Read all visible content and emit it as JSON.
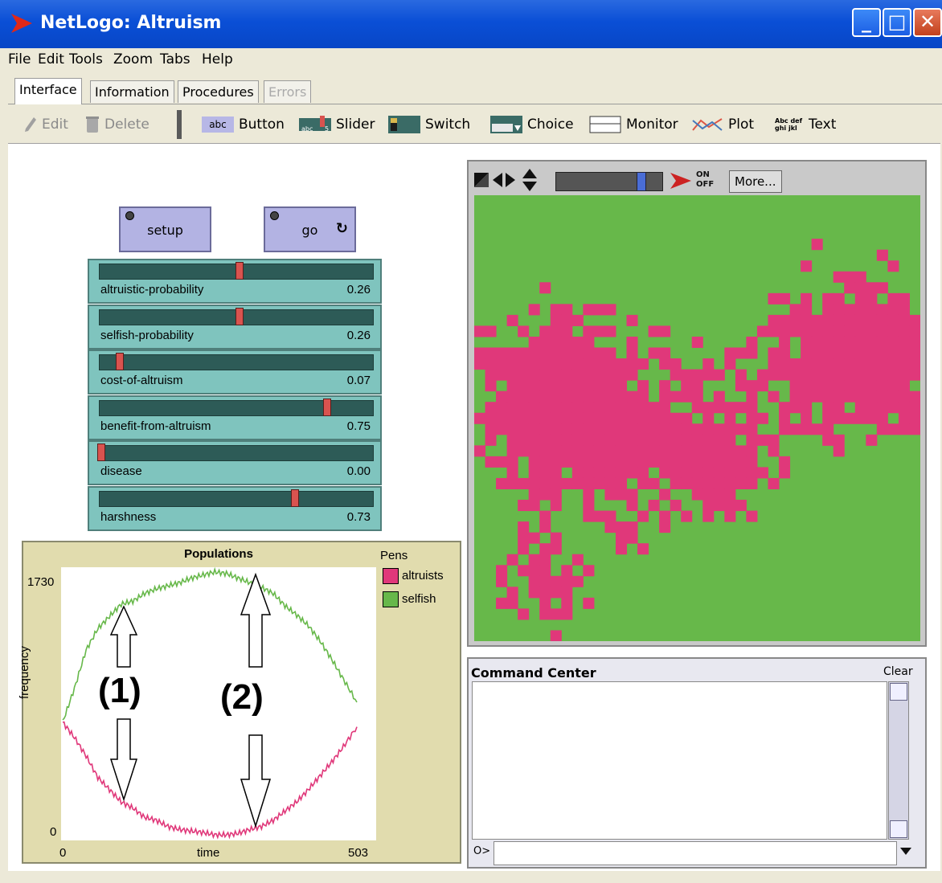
{
  "window": {
    "title": "NetLogo: Altruism"
  },
  "menu": [
    "File",
    "Edit",
    "Tools",
    "Zoom",
    "Tabs",
    "Help"
  ],
  "tabs": [
    "Interface",
    "Information",
    "Procedures",
    "Errors"
  ],
  "toolbar": {
    "edit": "Edit",
    "delete": "Delete",
    "button": "Button",
    "slider": "Slider",
    "switch": "Switch",
    "choice": "Choice",
    "monitor": "Monitor",
    "plot": "Plot",
    "text": "Text",
    "button_icon_text": "abc",
    "text_icon_text": "Abc def ghi jkl",
    "switch_icon_text": "On Off"
  },
  "buttons": {
    "setup": "setup",
    "go": "go"
  },
  "sliders": [
    {
      "name": "altruistic-probability",
      "value": "0.26",
      "fraction": 0.52
    },
    {
      "name": "selfish-probability",
      "value": "0.26",
      "fraction": 0.52
    },
    {
      "name": "cost-of-altruism",
      "value": "0.07",
      "fraction": 0.07
    },
    {
      "name": "benefit-from-altruism",
      "value": "0.75",
      "fraction": 0.85
    },
    {
      "name": "disease",
      "value": "0.00",
      "fraction": 0.0
    },
    {
      "name": "harshness",
      "value": "0.73",
      "fraction": 0.73
    }
  ],
  "view_toolbar": {
    "more": "More...",
    "on_off": "ON OFF",
    "speed_fraction": 0.82
  },
  "command_center": {
    "title": "Command Center",
    "clear": "Clear",
    "prompt": "O>"
  },
  "colors": {
    "altruists": "#e0387a",
    "selfish": "#67b84a"
  },
  "chart_data": {
    "type": "line",
    "title": "Populations",
    "xlabel": "time",
    "ylabel": "frequency",
    "xlim": [
      0,
      503
    ],
    "ylim": [
      0,
      1730
    ],
    "x_ticks": [
      "0",
      "503"
    ],
    "y_ticks": [
      "1730",
      "0"
    ],
    "legend_title": "Pens",
    "series": [
      {
        "name": "altruists",
        "color": "#e0387a",
        "x": [
          0,
          20,
          40,
          60,
          80,
          100,
          120,
          140,
          160,
          180,
          200,
          220,
          240,
          260,
          280,
          300,
          320,
          340,
          360,
          380,
          400,
          420,
          440,
          460,
          480,
          503
        ],
        "values": [
          740,
          640,
          520,
          380,
          300,
          220,
          180,
          120,
          100,
          60,
          40,
          30,
          20,
          5,
          5,
          15,
          40,
          60,
          100,
          160,
          220,
          300,
          390,
          480,
          580,
          710
        ]
      },
      {
        "name": "selfish",
        "color": "#67b84a",
        "x": [
          0,
          20,
          40,
          60,
          80,
          100,
          120,
          140,
          160,
          180,
          200,
          220,
          240,
          260,
          280,
          300,
          320,
          340,
          360,
          380,
          400,
          420,
          440,
          460,
          480,
          503
        ],
        "values": [
          740,
          960,
          1210,
          1350,
          1430,
          1510,
          1530,
          1580,
          1610,
          1630,
          1650,
          1680,
          1700,
          1720,
          1710,
          1680,
          1650,
          1620,
          1580,
          1500,
          1440,
          1370,
          1270,
          1150,
          1020,
          870
        ]
      }
    ]
  },
  "annotations": {
    "label_1": "(1)",
    "label_2": "(2)"
  }
}
